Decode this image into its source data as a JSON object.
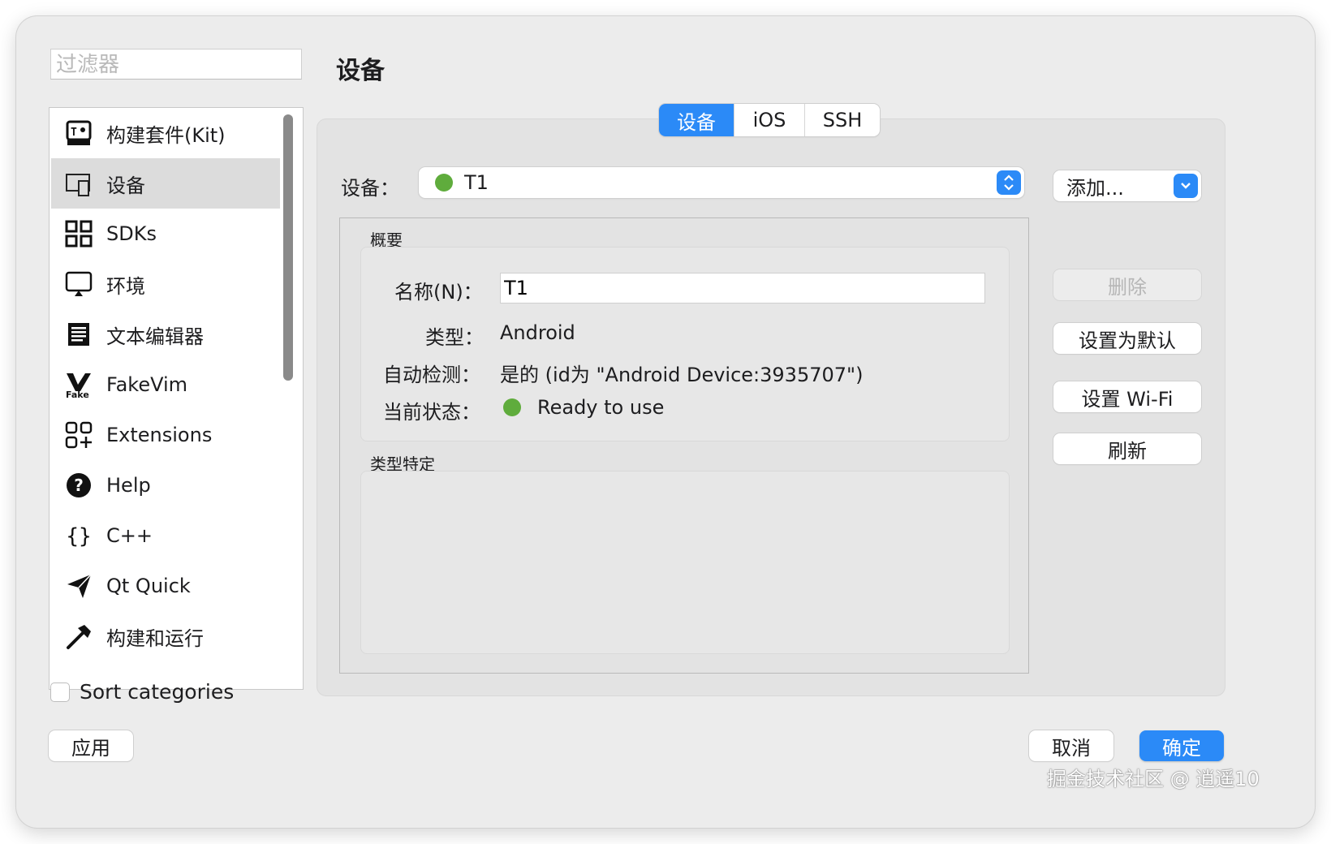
{
  "filter": {
    "placeholder": "过滤器"
  },
  "page_title": "设备",
  "sidebar": {
    "items": [
      {
        "label": "构建套件(Kit)",
        "icon": "kit-icon",
        "selected": false
      },
      {
        "label": "设备",
        "icon": "device-icon",
        "selected": true
      },
      {
        "label": "SDKs",
        "icon": "grid-icon",
        "selected": false
      },
      {
        "label": "环境",
        "icon": "monitor-icon",
        "selected": false
      },
      {
        "label": "文本编辑器",
        "icon": "document-icon",
        "selected": false
      },
      {
        "label": "FakeVim",
        "icon": "fakevim-icon",
        "selected": false
      },
      {
        "label": "Extensions",
        "icon": "extensions-icon",
        "selected": false
      },
      {
        "label": "Help",
        "icon": "help-icon",
        "selected": false
      },
      {
        "label": "C++",
        "icon": "braces-icon",
        "selected": false
      },
      {
        "label": "Qt Quick",
        "icon": "paper-plane-icon",
        "selected": false
      },
      {
        "label": "构建和运行",
        "icon": "hammer-icon",
        "selected": false
      }
    ],
    "fakevim_icon_text": "Fake"
  },
  "sort": {
    "label": "Sort categories",
    "checked": false
  },
  "tabs": [
    {
      "label": "设备",
      "active": true
    },
    {
      "label": "iOS",
      "active": false
    },
    {
      "label": "SSH",
      "active": false
    }
  ],
  "device": {
    "label": "设备：",
    "selected": "T1",
    "add_label": "添加..."
  },
  "overview": {
    "title": "概要",
    "name_label": "名称(N)：",
    "name_value": "T1",
    "type_label": "类型：",
    "type_value": "Android",
    "auto_label": "自动检测：",
    "auto_value": "是的 (id为 \"Android Device:3935707\")",
    "state_label": "当前状态：",
    "state_value": "Ready to use"
  },
  "type_specific": {
    "title": "类型特定"
  },
  "actions": {
    "delete": "删除",
    "set_default": "设置为默认",
    "setup_wifi": "设置 Wi-Fi",
    "refresh": "刷新"
  },
  "footer": {
    "apply": "应用",
    "cancel": "取消",
    "ok": "确定"
  },
  "watermark": "掘金技术社区 @ 逍遥10",
  "colors": {
    "accent": "#2b8af7",
    "status_green": "#5fac3c",
    "selected_row": "#dcdcdc"
  }
}
